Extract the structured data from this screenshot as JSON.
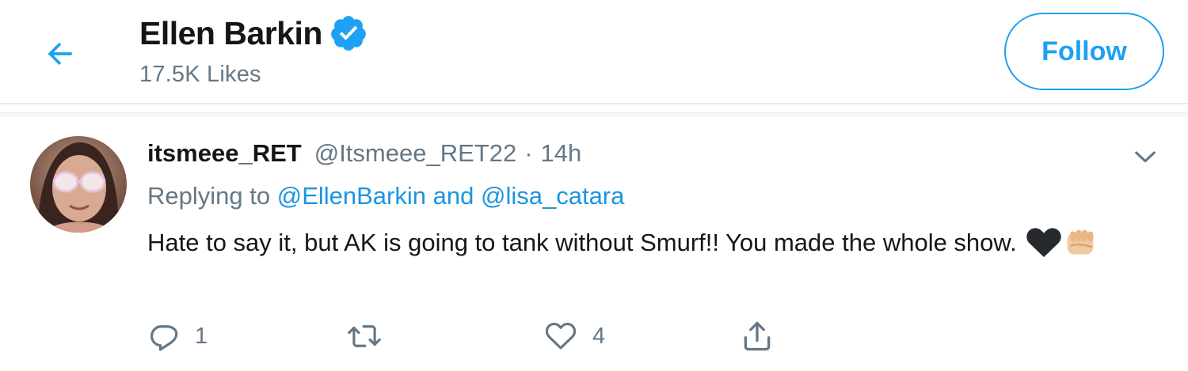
{
  "header": {
    "title": "Ellen Barkin",
    "likes": "17.5K Likes",
    "follow_label": "Follow"
  },
  "tweet": {
    "display_name": "itsmeee_RET",
    "handle": "@Itsmeee_RET22",
    "separator": "·",
    "time": "14h",
    "replying_prefix": "Replying to",
    "mention_1": "@EllenBarkin",
    "and_word": "and",
    "mention_2": "@lisa_catara",
    "text": "Hate to say it, but AK is going to tank without Smurf!! You made the whole show.",
    "reply_count": "1",
    "retweet_count": "",
    "like_count": "4"
  },
  "colors": {
    "accent": "#1da1f2",
    "link": "#1b95e0",
    "secondary_text": "#657786",
    "border": "#e6ecf0"
  },
  "icons": {
    "back": "arrow-left-icon",
    "verified": "verified-badge-icon",
    "more": "chevron-down-icon",
    "reply": "reply-icon",
    "retweet": "retweet-icon",
    "like": "heart-icon",
    "share": "share-icon"
  }
}
